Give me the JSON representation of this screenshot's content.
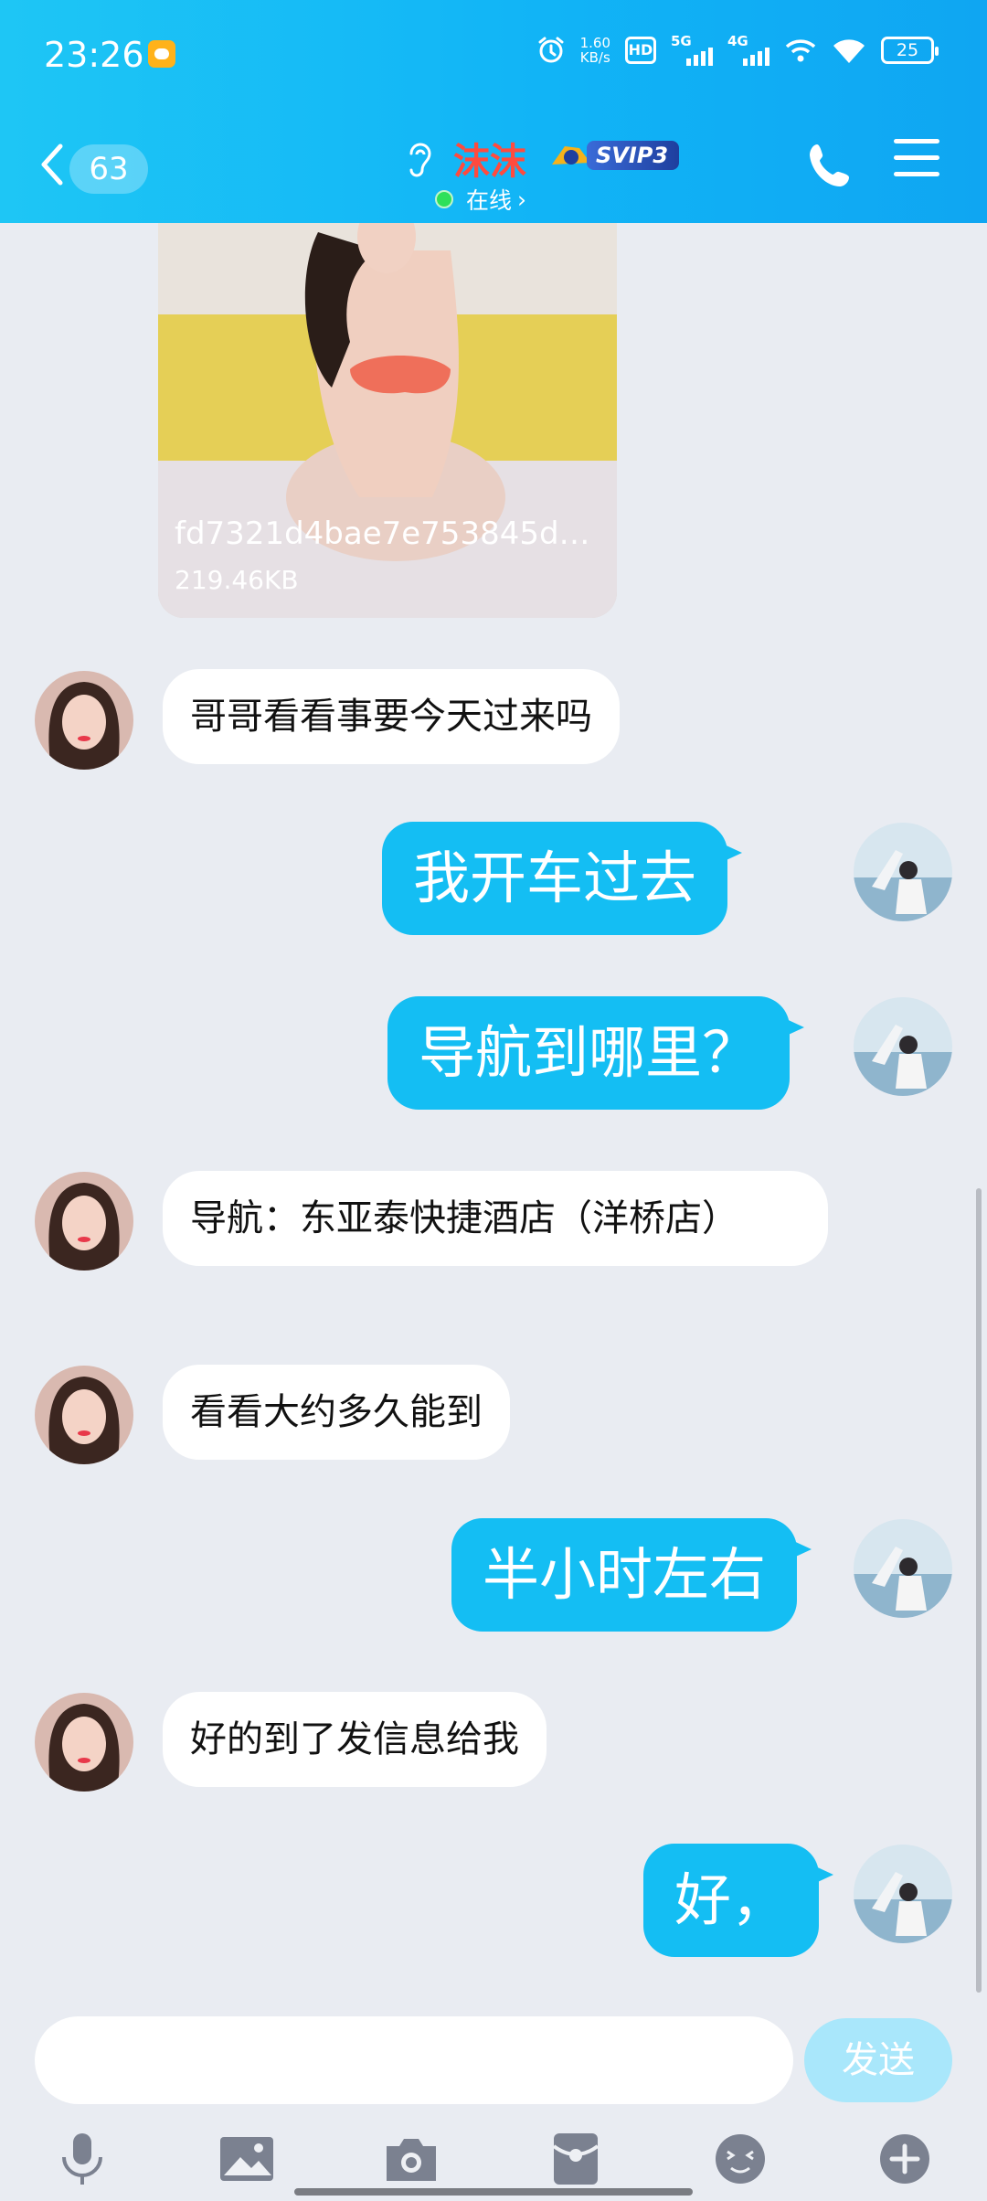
{
  "status_bar": {
    "time": "23:26",
    "net_speed_value": "1.60",
    "net_speed_unit": "KB/s",
    "hd_label": "HD",
    "sim1_type": "5G",
    "sim2_type": "4G",
    "battery_level": "25"
  },
  "header": {
    "back_count": "63",
    "contact_name": "沫沫",
    "vip_badge": "SVIP3",
    "online_status": "在线",
    "online_chevron": "›"
  },
  "messages": {
    "image": {
      "file_name": "fd7321d4bae7e753845d…",
      "file_size": "219.46KB"
    },
    "m1": "哥哥看看事要今天过来吗",
    "m2": "我开车过去",
    "m3": "导航到哪里？",
    "m4": "导航：东亚泰快捷酒店（洋桥店）",
    "m5": "看看大约多久能到",
    "m6": "半小时左右",
    "m7": "好的到了发信息给我",
    "m8": "好，"
  },
  "input_bar": {
    "placeholder": "",
    "send_label": "发送"
  },
  "toolbar_icons": [
    "microphone-icon",
    "image-icon",
    "camera-icon",
    "red-packet-icon",
    "emoji-icon",
    "plus-icon"
  ],
  "colors": {
    "header_start": "#1ec6f5",
    "header_end": "#0fa6f2",
    "outgoing_bubble": "#14bef3",
    "incoming_bubble": "#ffffff",
    "send_button": "#a9e7fb",
    "contact_name": "#ff4b3e",
    "online_dot": "#2ee05a"
  }
}
